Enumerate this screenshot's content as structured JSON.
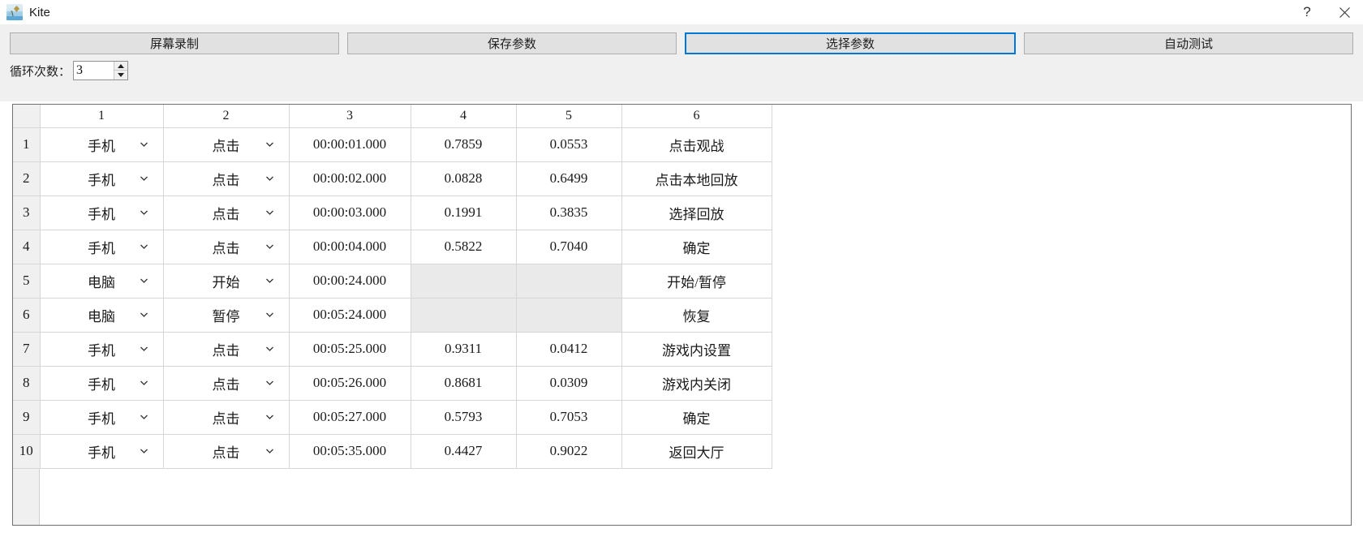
{
  "window": {
    "title": "Kite",
    "icon": "kite-app-icon",
    "help_label": "?",
    "close_label": "✕"
  },
  "toolbar": {
    "buttons": [
      {
        "label": "屏幕录制",
        "name": "screen-record-button",
        "focused": false
      },
      {
        "label": "保存参数",
        "name": "save-params-button",
        "focused": false
      },
      {
        "label": "选择参数",
        "name": "select-params-button",
        "focused": true
      },
      {
        "label": "自动测试",
        "name": "auto-test-button",
        "focused": false
      }
    ],
    "accent_color": "#0078d7"
  },
  "loop": {
    "label": "循环次数：",
    "value": "3",
    "placeholder": ""
  },
  "table": {
    "corner_header": "",
    "headers": [
      "1",
      "2",
      "3",
      "4",
      "5",
      "6"
    ],
    "rows": [
      {
        "num": "1",
        "c1": "手机",
        "c2": "点击",
        "c3": "00:00:01.000",
        "c4": "0.7859",
        "c5": "0.0553",
        "c6": "点击观战",
        "disabled": false
      },
      {
        "num": "2",
        "c1": "手机",
        "c2": "点击",
        "c3": "00:00:02.000",
        "c4": "0.0828",
        "c5": "0.6499",
        "c6": "点击本地回放",
        "disabled": false
      },
      {
        "num": "3",
        "c1": "手机",
        "c2": "点击",
        "c3": "00:00:03.000",
        "c4": "0.1991",
        "c5": "0.3835",
        "c6": "选择回放",
        "disabled": false
      },
      {
        "num": "4",
        "c1": "手机",
        "c2": "点击",
        "c3": "00:00:04.000",
        "c4": "0.5822",
        "c5": "0.7040",
        "c6": "确定",
        "disabled": false
      },
      {
        "num": "5",
        "c1": "电脑",
        "c2": "开始",
        "c3": "00:00:24.000",
        "c4": "",
        "c5": "",
        "c6": "开始/暂停",
        "disabled": true
      },
      {
        "num": "6",
        "c1": "电脑",
        "c2": "暂停",
        "c3": "00:05:24.000",
        "c4": "",
        "c5": "",
        "c6": "恢复",
        "disabled": true
      },
      {
        "num": "7",
        "c1": "手机",
        "c2": "点击",
        "c3": "00:05:25.000",
        "c4": "0.9311",
        "c5": "0.0412",
        "c6": "游戏内设置",
        "disabled": false
      },
      {
        "num": "8",
        "c1": "手机",
        "c2": "点击",
        "c3": "00:05:26.000",
        "c4": "0.8681",
        "c5": "0.0309",
        "c6": "游戏内关闭",
        "disabled": false
      },
      {
        "num": "9",
        "c1": "手机",
        "c2": "点击",
        "c3": "00:05:27.000",
        "c4": "0.5793",
        "c5": "0.7053",
        "c6": "确定",
        "disabled": false
      },
      {
        "num": "10",
        "c1": "手机",
        "c2": "点击",
        "c3": "00:05:35.000",
        "c4": "0.4427",
        "c5": "0.9022",
        "c6": "返回大厅",
        "disabled": false
      }
    ]
  }
}
